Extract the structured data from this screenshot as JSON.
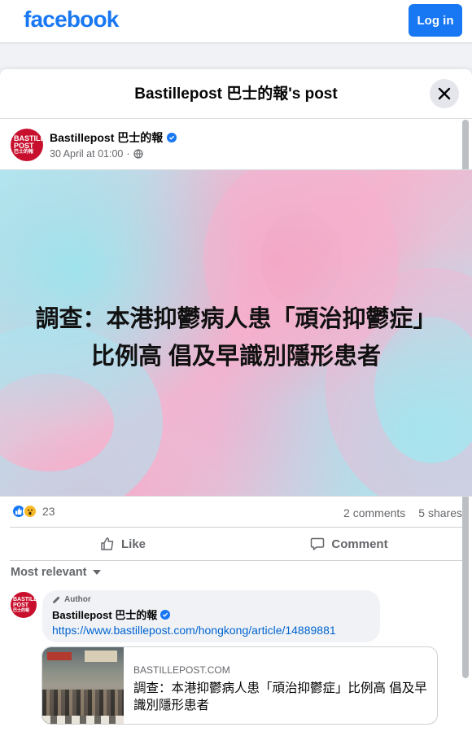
{
  "topbar": {
    "logo": "facebook",
    "login_label": "Log in"
  },
  "dialog": {
    "title": "Bastillepost 巴士的報's post"
  },
  "post": {
    "page_name": "Bastillepost 巴士的報",
    "date": "30 April at 01:00",
    "separator": "·",
    "avatar_lines": [
      "BASTILLE",
      "POST",
      "巴士的報"
    ],
    "image_headline": [
      "調查：本港抑鬱病人患「頑治抑鬱症」",
      "比例高 倡及早識別隱形患者"
    ],
    "reaction_count": "23",
    "comments_count": "2 comments",
    "shares_count": "5 shares"
  },
  "actions": {
    "like_label": "Like",
    "comment_label": "Comment"
  },
  "comments": {
    "sort_label": "Most relevant",
    "first": {
      "author_tag": "Author",
      "name": "Bastillepost 巴士的報",
      "link": "https://www.bastillepost.com/hongkong/article/14889881"
    }
  },
  "link_card": {
    "domain": "BASTILLEPOST.COM",
    "title": "調查：本港抑鬱病人患「頑治抑鬱症」比例高 倡及早識別隱形患者"
  },
  "colors": {
    "brand": "#1877f2",
    "link": "#0064d1",
    "avatar_red": "#c8102e"
  }
}
